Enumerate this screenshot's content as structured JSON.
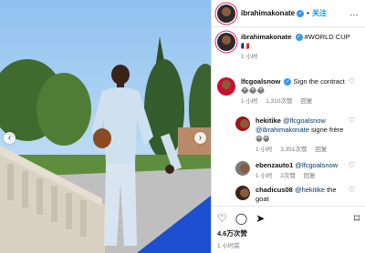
{
  "header": {
    "username": "ibrahimakonate",
    "separator": "•",
    "follow_label": "关注",
    "more_label": "…"
  },
  "caption": {
    "username": "ibrahimakonate",
    "text": "#WORLD CUP",
    "emoji": "🇫🇷",
    "time": "1 小时"
  },
  "comments": [
    {
      "username": "lfcgoalsnow",
      "text": "Sign the contract",
      "emojis": "😂😂😂",
      "time": "1 小时",
      "likes": "1,310次赞",
      "reply": "回复"
    }
  ],
  "replies": [
    {
      "username": "hekitike",
      "mention1": "@lfcgoalsnow",
      "mention2": "@ibrahimakonate",
      "text": "signe frère",
      "emojis": "😁😁",
      "time": "1 小时",
      "likes": "3,351次赞",
      "reply": "回复"
    },
    {
      "username": "ebenzauto1",
      "mention": "@lfcgoalsnow",
      "time": "1 小时",
      "likes": "2次赞",
      "reply": "回复"
    },
    {
      "username": "chadicus08",
      "mention": "@hekitike",
      "text": "the goat"
    }
  ],
  "footer": {
    "likes": "4.6万次赞",
    "time": "1 小时前"
  },
  "icons": {
    "heart": "heart-icon",
    "comment": "comment-icon",
    "share": "send-icon",
    "save": "bookmark-icon",
    "verified": "verified-badge-icon"
  },
  "colors": {
    "follow": "#0095f6",
    "verified": "#3897f0",
    "mention": "#00376b"
  }
}
